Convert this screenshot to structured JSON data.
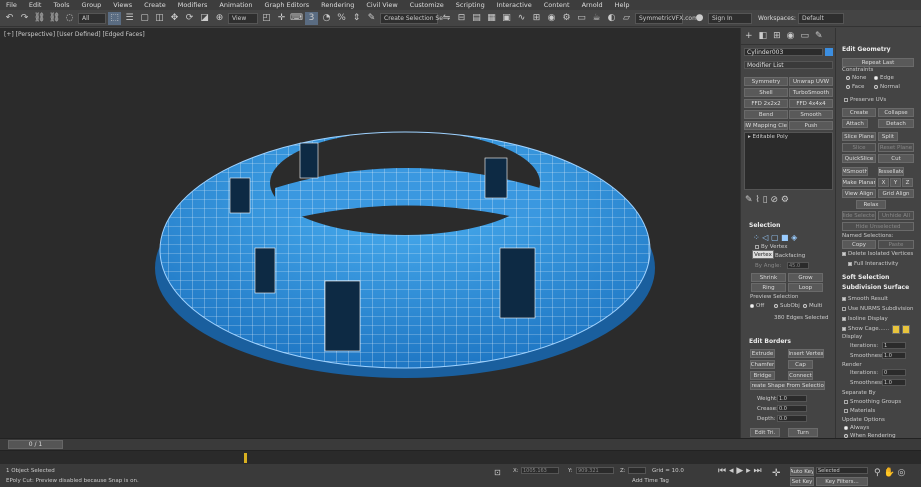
{
  "menu": [
    "File",
    "Edit",
    "Tools",
    "Group",
    "Views",
    "Create",
    "Modifiers",
    "Animation",
    "Graph Editors",
    "Rendering",
    "Civil View",
    "Customize",
    "Scripting",
    "Interactive",
    "Content",
    "Arnold",
    "Help"
  ],
  "account": {
    "url": "SymmetricVFX.com",
    "sign_in": "Sign In",
    "workspaces_label": "Workspaces:",
    "workspace": "Default"
  },
  "toolbar": {
    "filter": "All",
    "refcoord": "View",
    "selset": "Create Selection Se"
  },
  "viewport": {
    "label": "[+] [Perspective] [User Defined] [Edged Faces]"
  },
  "command_panel": {
    "object_name": "Cylinder003",
    "modifier_list": "Modifier List",
    "modifier_buttons": [
      "Symmetry",
      "Unwrap UVW",
      "Shell",
      "TurboSmooth",
      "FFD 2x2x2",
      "FFD 4x4x4",
      "Bend",
      "Smooth",
      "NW Mapping Clea",
      "Push"
    ],
    "stack_item": "Editable Poly",
    "selection": {
      "header": "Selection",
      "by_vertex": "By Vertex",
      "vertex_tooltip": "Vertex",
      "backfacing": "Backfacing",
      "by_angle": "By Angle:",
      "by_angle_val": "45.0",
      "shrink": "Shrink",
      "grow": "Grow",
      "ring": "Ring",
      "loop": "Loop",
      "preview": "Preview Selection",
      "off": "Off",
      "subobj": "SubObj",
      "multi": "Multi",
      "edges_selected": "380 Edges Selected"
    },
    "edit_borders": {
      "header": "Edit Borders",
      "extrude": "Extrude",
      "insert_vertex": "Insert Vertex",
      "chamfer": "Chamfer",
      "cap": "Cap",
      "bridge": "Bridge",
      "connect": "Connect",
      "create_shape": "Create Shape From Selection",
      "weight": "Weight:",
      "weight_val": "1.0",
      "crease": "Crease:",
      "crease_val": "0.0",
      "depth": "Depth:",
      "depth_val": "0.0",
      "edit_tri": "Edit Tri.",
      "turn": "Turn"
    }
  },
  "edit_geometry": {
    "header": "Edit Geometry",
    "repeat_last": "Repeat Last",
    "constraints": "Constraints",
    "none": "None",
    "edge": "Edge",
    "face": "Face",
    "normal": "Normal",
    "preserve_uvs": "Preserve UVs",
    "create": "Create",
    "collapse": "Collapse",
    "attach": "Attach",
    "detach": "Detach",
    "slice_plane": "Slice Plane",
    "split": "Split",
    "slice": "Slice",
    "reset_plane": "Reset Plane",
    "quickslice": "QuickSlice",
    "cut": "Cut",
    "msmooth": "MSmooth",
    "tessellate": "Tessellate",
    "make_planar": "Make Planar",
    "x": "X",
    "y": "Y",
    "z": "Z",
    "view_align": "View Align",
    "grid_align": "Grid Align",
    "relax": "Relax",
    "hide_selected": "Hide Selected",
    "unhide_all": "Unhide All",
    "hide_unselected": "Hide Unselected",
    "named_selections": "Named Selections:",
    "copy": "Copy",
    "paste": "Paste",
    "delete_isolated": "Delete Isolated Vertices",
    "full_interactivity": "Full Interactivity",
    "soft_selection": "Soft Selection",
    "subdivision_surface": "Subdivision Surface",
    "smooth_result": "Smooth Result",
    "use_nurms": "Use NURMS Subdivision",
    "isoline_display": "Isoline Display",
    "show_cage": "Show Cage......",
    "display": "Display",
    "iterations": "Iterations:",
    "iter_val": "1",
    "smoothness": "Smoothness:",
    "smooth_val": "1.0",
    "render": "Render",
    "render_iter": "0",
    "render_smooth": "1.0",
    "separate_by": "Separate By",
    "smoothing_groups": "Smoothing Groups",
    "materials": "Materials",
    "update_options": "Update Options",
    "always": "Always",
    "when_rendering": "When Rendering"
  },
  "timeline": {
    "frame": "0 / 1"
  },
  "status": {
    "objects": "1 Object Selected",
    "prompt": "EPoly Cut: Preview disabled because Snap is on.",
    "x_label": "X:",
    "x_val": "1005.163",
    "y_label": "Y:",
    "y_val": "909.321",
    "z_label": "Z:",
    "grid": "Grid = 10.0",
    "add_time_tag": "Add Time Tag",
    "auto_key": "Auto Key",
    "selected": "Selected",
    "set_key": "Set Key",
    "key_filters": "Key Filters..."
  }
}
